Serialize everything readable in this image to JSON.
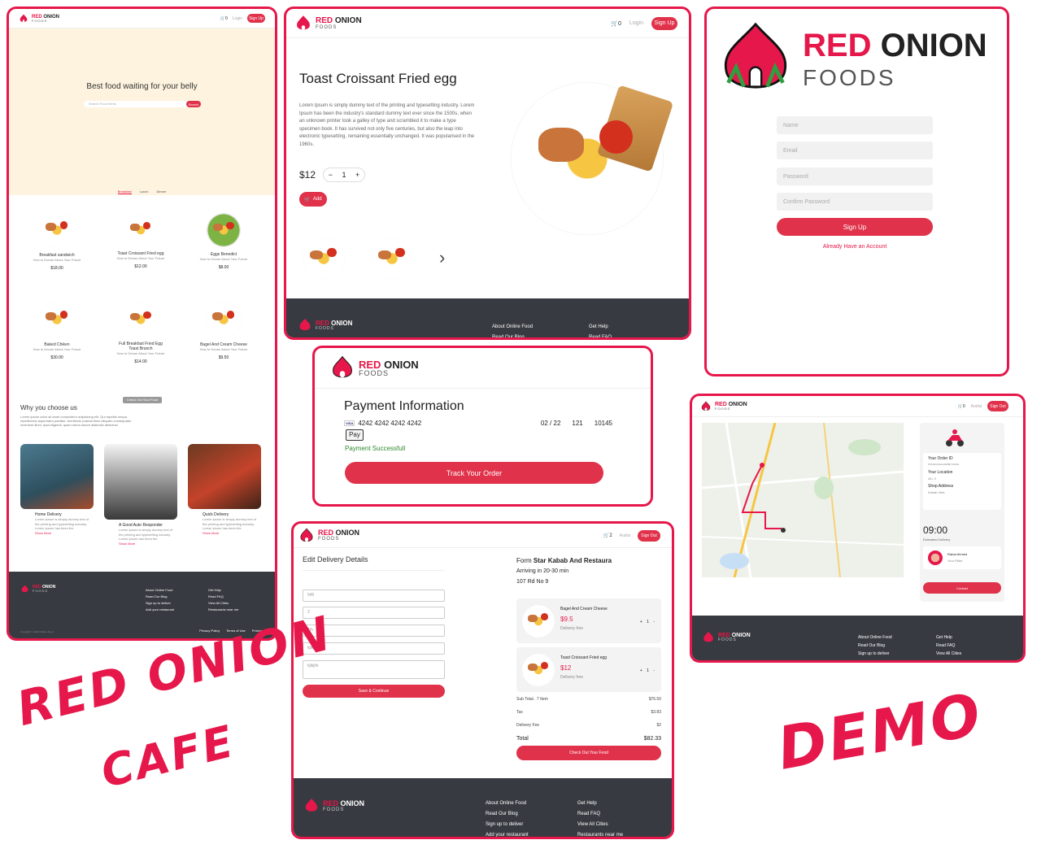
{
  "brand": {
    "red": "RED",
    "onion": "ONION",
    "foods": "FOODS",
    "accent": "#e6174a",
    "footer_bg": "#373a40"
  },
  "home": {
    "nav": {
      "cart_count": "0",
      "login": "Login",
      "signup": "Sign Up"
    },
    "hero_title": "Best food waiting for your belly",
    "search_placeholder": "Search Food Items",
    "search_button": "Search",
    "tabs": [
      "Breakfast",
      "Lunch",
      "Dinner"
    ],
    "items": [
      {
        "name": "Breakfast sandwich",
        "caption": "How to Dream About Your Future",
        "price": "$18.00"
      },
      {
        "name": "Toast Croissant Fried egg",
        "caption": "How to Dream About Your Future",
        "price": "$12.00"
      },
      {
        "name": "Eggs Benedict",
        "caption": "How to Dream About Your Future",
        "price": "$8.00"
      },
      {
        "name": "Baked Chiken",
        "caption": "How to Dream About Your Future",
        "price": "$30.00"
      },
      {
        "name": "Full Breakfast Fried Egg Toast Brunch",
        "caption": "How to Dream About Your Future",
        "price": "$14.00"
      },
      {
        "name": "Bagel And Cream Cheese",
        "caption": "How to Dream About Your Future",
        "price": "$9.50"
      }
    ],
    "checkout_button": "Check Out Your Food",
    "why_title": "Why you choose us",
    "why_text": "Lorem ipsum dolor sit amet consectetur adipisicing elit. Qui repellat nequa repellendus aspernatur pariatur. Architecto praesentium aliquam consequatur inventore illum. Ipsa eligendi, quam nemo dolore distinctio delectus!",
    "features": [
      {
        "title": "Home Delivery",
        "text": "Lorem Ipsum is simply dummy text of the printing and typesetting industry. Lorem Ipsum has been the",
        "link": "Show More"
      },
      {
        "title": "A Good Auto Responder",
        "text": "Lorem Ipsum is simply dummy text of the printing and typesetting industry. Lorem Ipsum has been the",
        "link": "Show More"
      },
      {
        "title": "Quick Delivery",
        "text": "Lorem Ipsum is simply dummy text of the printing and typesetting industry. Lorem Ipsum has been the",
        "link": "Show More"
      }
    ],
    "footer": {
      "col1": [
        "About Online Food",
        "Read Our Blog",
        "Sign up to deliver",
        "Add your restaurant"
      ],
      "col2": [
        "Get Help",
        "Read FAQ",
        "View All Cities",
        "Restaurants near me"
      ],
      "copyright": "Copyright © 2020 Online Food",
      "links": [
        "Privacy Policy",
        "Terms of Use",
        "Pricing"
      ]
    }
  },
  "detail": {
    "nav": {
      "cart_count": "0",
      "login": "Login",
      "signup": "Sign Up"
    },
    "title": "Toast Croissant Fried egg",
    "description": "Lorem Ipsum is simply dummy text of the printing and typesetting industry. Lorem Ipsum has been the industry's standard dummy text ever since the 1500s, when an unknown printer took a galley of type and scrambled it to make a type specimen book. It has survived not only five centuries, but also the leap into electronic typesetting, remaining essentially unchanged. It was popularised in the 1960s.",
    "price": "$12",
    "qty": "1",
    "minus": "−",
    "plus": "+",
    "add": "Add",
    "next_arrow": "›",
    "footer": {
      "col1": [
        "About Online Food",
        "Read Our Blog"
      ],
      "col2": [
        "Get Help",
        "Read FAQ"
      ]
    }
  },
  "signup": {
    "name_placeholder": "Name",
    "email_placeholder": "Email",
    "password_placeholder": "Password",
    "confirm_placeholder": "Confirm Password",
    "button": "Sign Up",
    "already": "Already Have an Account"
  },
  "payment": {
    "title": "Payment Information",
    "card_brand": "VISA",
    "card_number": "4242 4242 4242 4242",
    "expiry": "02 / 22",
    "cvc": "121",
    "zip": "10145",
    "pay": "Pay",
    "success": "Payment Successfull",
    "track": "Track Your Order"
  },
  "checkout": {
    "nav": {
      "cart_count": "2",
      "user": "Arafat",
      "signout": "Sign Out"
    },
    "edit_title": "Edit Delivery Details",
    "fields": [
      "545",
      "2",
      "4/h",
      "kjlkj",
      "kjlkjlrk"
    ],
    "save": "Save & Continue",
    "from_label": "Form",
    "restaurant": "Star Kabab And Restaura",
    "arriving": "Arriving in 20-30 min",
    "address": "107 Rd No 9",
    "cart": [
      {
        "name": "Bagel And Cream Cheese",
        "price": "$9.5",
        "delivery": "Delivery free",
        "qty": "+ 1 -"
      },
      {
        "name": "Toast Croissant Fried egg",
        "price": "$12",
        "delivery": "Delivery free",
        "qty": "+ 1 -"
      }
    ],
    "summary": [
      {
        "label": "Sub Total . 7 Item",
        "value": "$76.50"
      },
      {
        "label": "Tax",
        "value": "$3.83"
      },
      {
        "label": "Delivery Fee",
        "value": "$2"
      }
    ],
    "total_label": "Total",
    "total_value": "$82.33",
    "checkout_btn": "Check Out Your Food",
    "footer": {
      "col1": [
        "About Online Food",
        "Read Our Blog",
        "Sign up to deliver",
        "Add your restaurant"
      ],
      "col2": [
        "Get Help",
        "Read FAQ",
        "View All Cities",
        "Restaurants near me"
      ]
    }
  },
  "tracking": {
    "nav": {
      "cart_count": "0",
      "user": "Arafat",
      "signout": "Sign Out"
    },
    "order_id_label": "Your Order ID",
    "order_id": "5f7b4d3c2a1e0d9f8b7c6a54",
    "location_label": "Your Location",
    "location": "4/h, 2",
    "shop_label": "Shop Address",
    "shop": "Kebab Vela",
    "time": "09:00",
    "estimated": "Estimated Delivery",
    "rider_name": "Rahat Ahmed",
    "rider_role": "Your Rider",
    "contact": "Contact",
    "footer": {
      "col1": [
        "About Online Food",
        "Read Our Blog",
        "Sign up to deliver"
      ],
      "col2": [
        "Get Help",
        "Read FAQ",
        "View All Cities"
      ]
    }
  },
  "labels": {
    "red_onion": "RED ONION",
    "cafe": "CAFE",
    "demo": "DEMO"
  }
}
